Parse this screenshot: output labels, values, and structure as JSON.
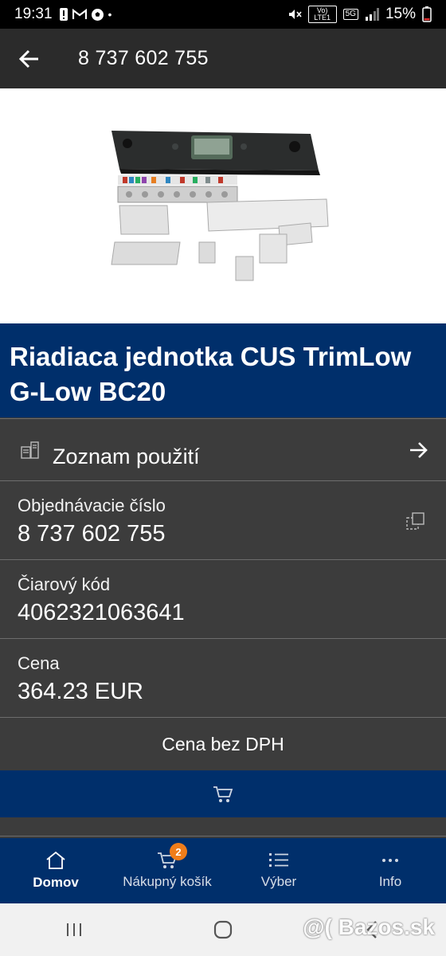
{
  "status_bar": {
    "time": "19:31",
    "net_tag": "Vo) LTE1",
    "net_5g": "5G",
    "battery": "15%"
  },
  "app_bar": {
    "back_icon": "arrow-left-icon",
    "title": "8 737 602 755"
  },
  "product": {
    "title": "Riadiaca jednotka CUS TrimLow G-Low BC20",
    "usage_label": "Zoznam použití",
    "order_label": "Objednávacie číslo",
    "order_value": "8 737 602 755",
    "barcode_label": "Čiarový kód",
    "barcode_value": "4062321063641",
    "price_label": "Cena",
    "price_value": "364.23 EUR",
    "price_note": "Cena bez DPH"
  },
  "bottom_nav": {
    "items": [
      {
        "label": "Domov",
        "icon": "home-icon",
        "active": true
      },
      {
        "label": "Nákupný košík",
        "icon": "cart-icon",
        "badge": "2"
      },
      {
        "label": "Výber",
        "icon": "list-icon"
      },
      {
        "label": "Info",
        "icon": "more-icon"
      }
    ]
  },
  "watermark": "@( Bazos.sk",
  "colors": {
    "brand_blue": "#002f6b",
    "surface": "#3c3c3c",
    "badge": "#f07d1a"
  }
}
